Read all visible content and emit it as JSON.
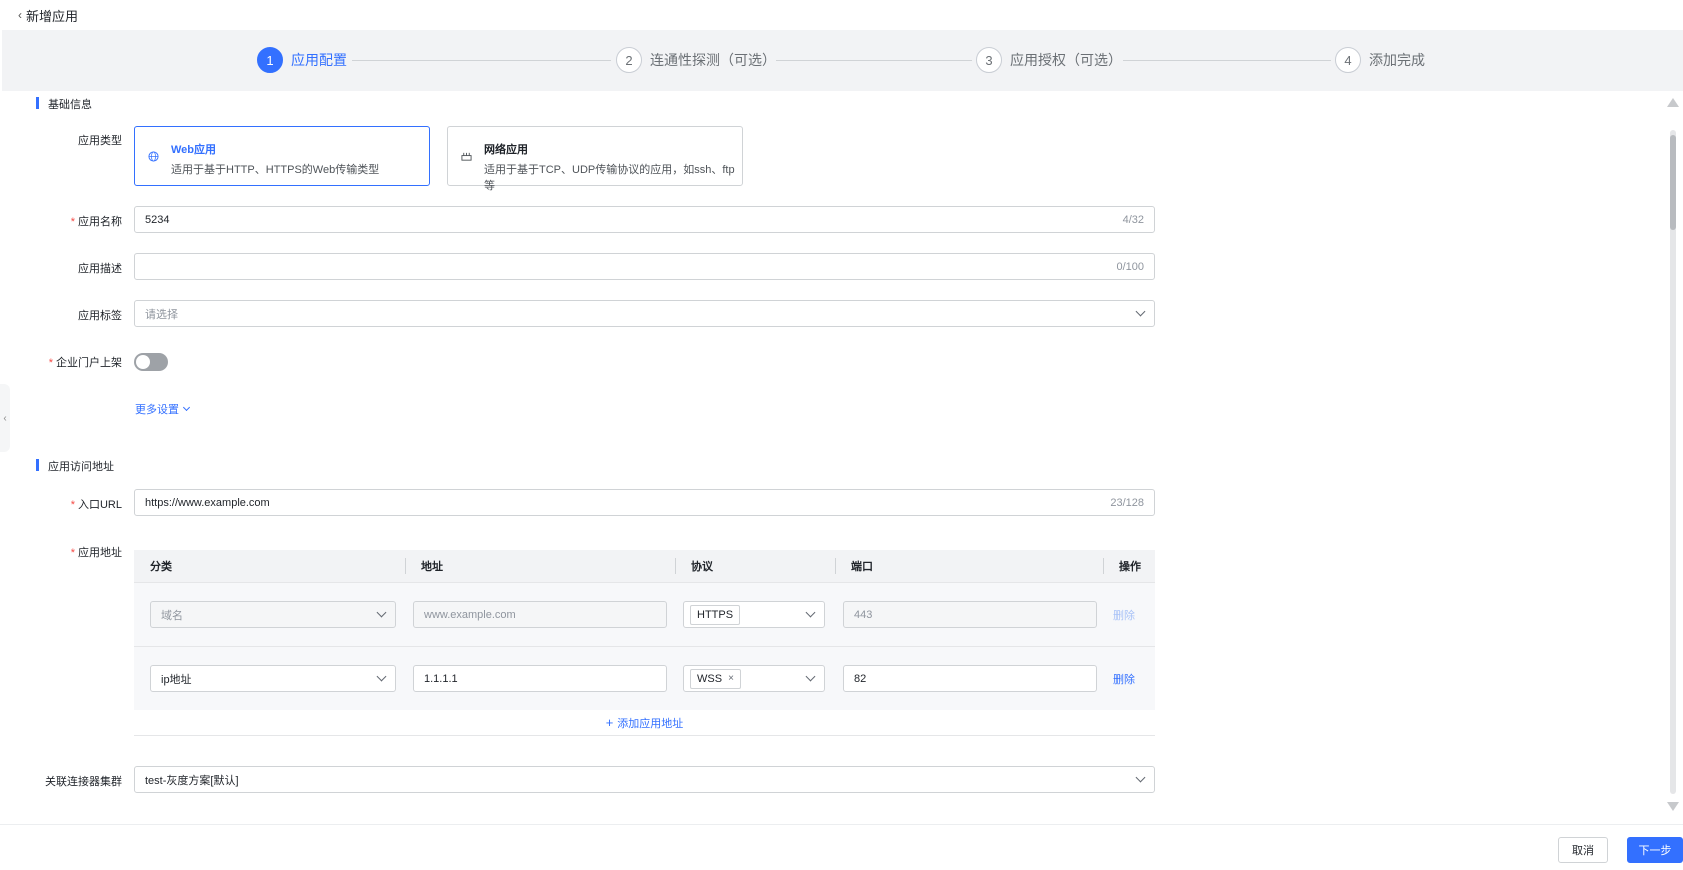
{
  "header": {
    "back_label": "新增应用"
  },
  "steps": [
    {
      "num": "1",
      "label": "应用配置"
    },
    {
      "num": "2",
      "label": "连通性探测（可选）"
    },
    {
      "num": "3",
      "label": "应用授权（可选）"
    },
    {
      "num": "4",
      "label": "添加完成"
    }
  ],
  "basic": {
    "title": "基础信息",
    "type_label": "应用类型",
    "cards": [
      {
        "title": "Web应用",
        "desc": "适用于基于HTTP、HTTPS的Web传输类型",
        "icon": "globe-icon"
      },
      {
        "title": "网络应用",
        "desc": "适用于基于TCP、UDP传输协议的应用，如ssh、ftp等",
        "icon": "network-icon"
      }
    ],
    "name_label": "应用名称",
    "name_value": "5234",
    "name_count": "4/32",
    "desc_label": "应用描述",
    "desc_count": "0/100",
    "tag_label": "应用标签",
    "tag_placeholder": "请选择",
    "portal_label": "企业门户上架",
    "more_label": "更多设置"
  },
  "access": {
    "title": "应用访问地址",
    "url_label": "入口URL",
    "url_value": "https://www.example.com",
    "url_count": "23/128",
    "addr_label": "应用地址",
    "columns": [
      "分类",
      "地址",
      "协议",
      "端口",
      "操作"
    ],
    "rows": [
      {
        "category": "域名",
        "address": "www.example.com",
        "protocol": "HTTPS",
        "port": "443",
        "action": "删除"
      },
      {
        "category": "ip地址",
        "address": "1.1.1.1",
        "protocol": "WSS",
        "port": "82",
        "action": "删除"
      }
    ],
    "add_label": "添加应用地址"
  },
  "cluster": {
    "label": "关联连接器集群",
    "value": "test-灰度方案[默认]"
  },
  "footer": {
    "cancel": "取消",
    "next": "下一步"
  },
  "colors": {
    "primary": "#3370ff",
    "required": "#f54a45"
  }
}
